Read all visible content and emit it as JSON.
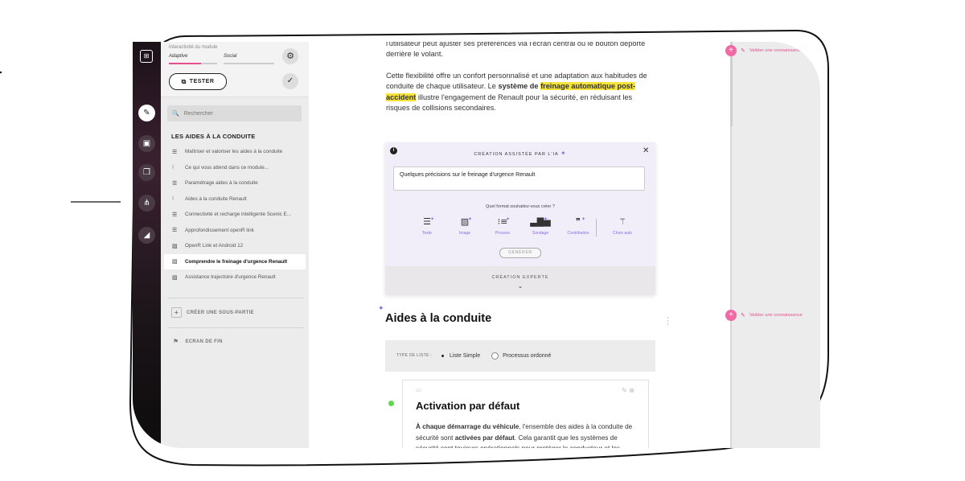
{
  "module": {
    "label": "Interactivité du module",
    "options": [
      "Adaptive",
      "Social"
    ],
    "tester_label": "TESTER"
  },
  "search": {
    "placeholder": "Rechercher"
  },
  "sidebar": {
    "section_title": "LES AIDES À LA CONDUITE",
    "items": [
      {
        "label": "Maîtriser et valoriser les aides à la conduite",
        "icon": "text-lines-icon"
      },
      {
        "label": "Ce qui vous attend dans ce module...",
        "icon": "list-icon"
      },
      {
        "label": "Paramétrage aides à la conduite",
        "icon": "text-lines-icon"
      },
      {
        "label": "Aides à la conduite Renault",
        "icon": "list-icon"
      },
      {
        "label": "Connectivité et recharge intelligente Scenic E...",
        "icon": "text-lines-icon"
      },
      {
        "label": "Approfondissement openR link",
        "icon": "text-lines-icon"
      },
      {
        "label": "OpenR Link et Android 12",
        "icon": "image-icon"
      },
      {
        "label": "Comprendre le freinage d'urgence Renault",
        "icon": "image-icon"
      },
      {
        "label": "Assistance trajectoire d'urgence Renault",
        "icon": "image-icon"
      }
    ],
    "selected_index": 7,
    "add_subpart": "CRÉER UNE SOUS-PARTIE",
    "end_screen": "ECRAN DE FIN"
  },
  "content": {
    "p1": "l'utilisateur peut ajuster ses préférences via l'écran central ou le bouton déporté derrière le volant.",
    "p2_a": "Cette flexibilité offre un confort personnalisé et une adaptation aux habitudes de conduite de chaque utilisateur. Le ",
    "p2_bold": "système de ",
    "p2_hl": "freinage automatique post-accident",
    "p2_b": " illustre l'engagement de Renault pour la sécurité, en réduisant les risques de collisions secondaires."
  },
  "ai_panel": {
    "title": "CRÉATION ASSISTÉE PAR L'IA",
    "prompt_value": "Quelques précisions sur le freinage d'urgence Renault",
    "question": "Quel format souhaitez-vous créer ?",
    "formats": [
      "Texte",
      "Image",
      "Process",
      "Sondage",
      "Contribution",
      "Choix auto"
    ],
    "generate_label": "GÉNÉRER",
    "expert_label": "CRÉATION EXPERTE"
  },
  "section": {
    "title": "Aides à la conduite",
    "list_type_label": "TYPE DE LISTE :",
    "list_type_options": [
      "Liste Simple",
      "Processus ordonné"
    ],
    "card_num": "1/3",
    "card_title": "Activation par défaut",
    "card_bold1": "À chaque démarrage du véhicule",
    "card_t1": ", l'ensemble des aides à la conduite de sécurité sont ",
    "card_bold2": "activées par défaut",
    "card_t2": ". Cela garantit que les systèmes de sécurité sont toujours opérationnels pour protéger le conducteur et les"
  },
  "right_panel": {
    "validate_label": "Valider une connaissance"
  },
  "colors": {
    "accent": "#e74e8e",
    "highlight": "#f5e23a",
    "ai_purple": "#8a6de0",
    "dot_green": "#5ed84a"
  }
}
